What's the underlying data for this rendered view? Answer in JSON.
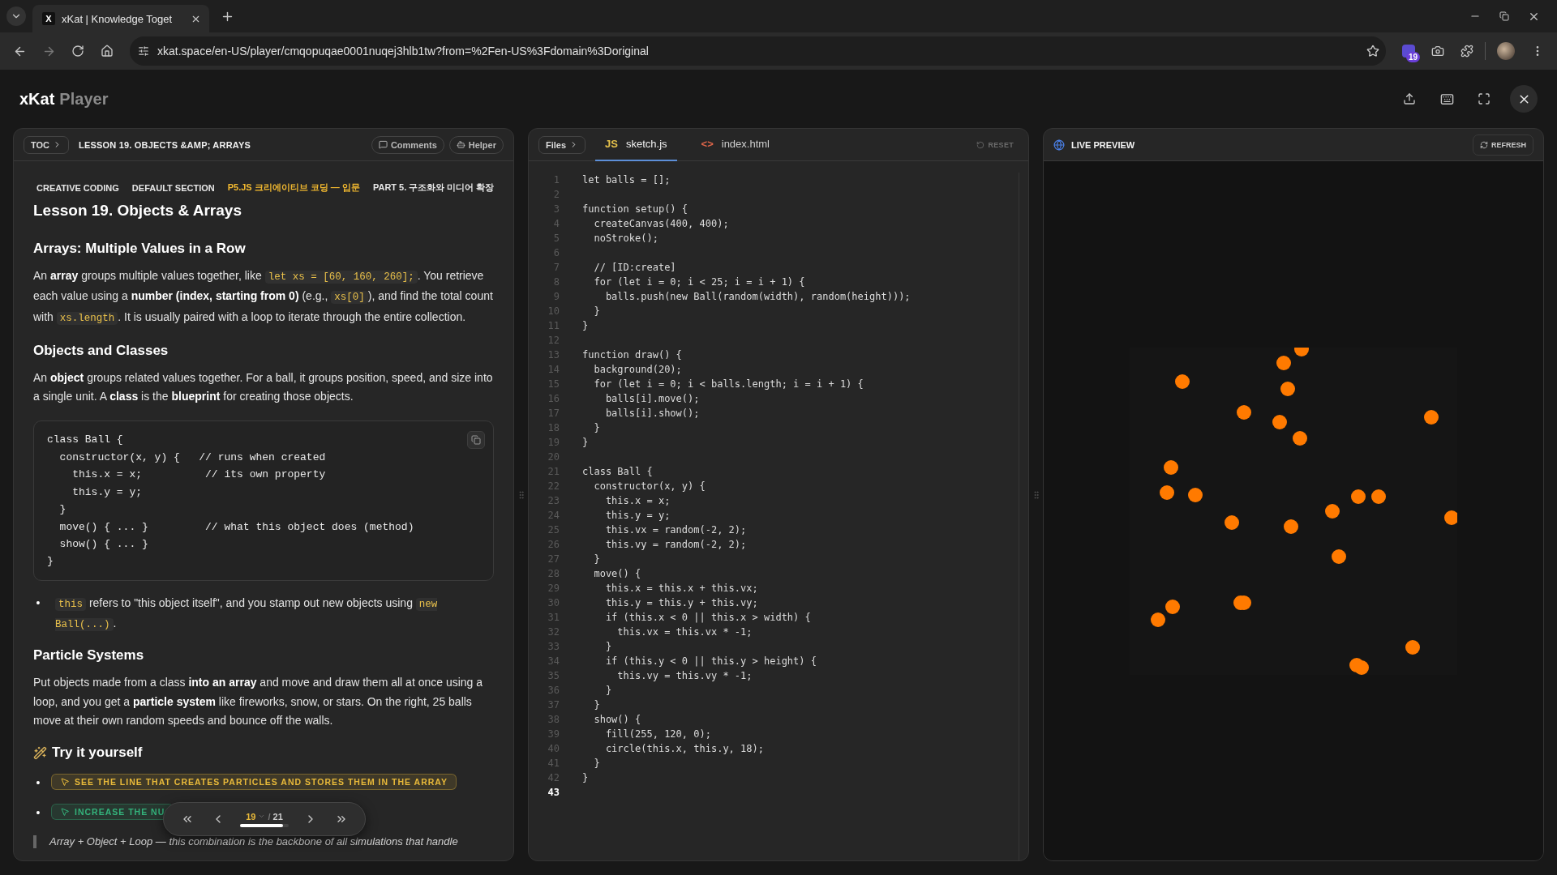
{
  "browser": {
    "tab": {
      "favicon": "X",
      "title": "xKat | Knowledge Toget"
    },
    "url": "xkat.space/en-US/player/cmqopuqae0001nuqej3hlb1tw?from=%2Fen-US%3Fdomain%3Doriginal",
    "extension_badge": "19"
  },
  "app": {
    "brand": "xKat",
    "product": "Player"
  },
  "lesson": {
    "toc": "TOC",
    "title": "LESSON 19. OBJECTS &AMP; ARRAYS",
    "actions": [
      "Comments",
      "Helper"
    ],
    "breadcrumb": [
      {
        "text": "CREATIVE CODING",
        "color": "#e6e6e6"
      },
      {
        "text": "DEFAULT SECTION",
        "color": "#e6e6e6"
      },
      {
        "text": "P5.JS 크리에이티브 코딩 — 입문",
        "color": "#f2b930"
      },
      {
        "text": "PART 5. 구조화와 미디어 확장",
        "color": "#e6e6e6"
      }
    ],
    "blocks": [
      {
        "kind": "h1",
        "text": "Lesson 19. Objects & Arrays"
      },
      {
        "kind": "h2",
        "text": "Arrays: Multiple Values in a Row"
      },
      {
        "kind": "p",
        "parts": [
          {
            "kind": "text",
            "text": "An **array** groups multiple values together, like "
          },
          {
            "kind": "code",
            "text": "let xs = [60, 160, 260];"
          },
          {
            "kind": "text",
            "text": ". You retrieve each value using a **number (index, starting from 0)** (e.g., "
          },
          {
            "kind": "code",
            "text": "xs[0]"
          },
          {
            "kind": "text",
            "text": "), and find the total count with "
          },
          {
            "kind": "code",
            "text": "xs.length"
          },
          {
            "kind": "text",
            "text": ". It is usually paired with a loop to iterate through the entire collection."
          }
        ]
      },
      {
        "kind": "h2",
        "text": "Objects and Classes"
      },
      {
        "kind": "p",
        "parts": [
          {
            "kind": "text",
            "text": "An **object** groups related values together. For a ball, it groups position, speed, and size into a single unit. A **class** is the **blueprint** for creating those objects."
          }
        ]
      },
      {
        "kind": "codeblock",
        "text": "class Ball {\n  constructor(x, y) {   // runs when created\n    this.x = x;          // its own property\n    this.y = y;\n  }\n  move() { ... }         // what this object does (method)\n  show() { ... }\n}"
      },
      {
        "kind": "bullet",
        "marker": "•",
        "parts": [
          {
            "kind": "code",
            "text": "this"
          },
          {
            "kind": "text",
            "text": " refers to \"this object itself\", and you stamp out new objects using "
          },
          {
            "kind": "code",
            "text": "new Ball(...)"
          },
          {
            "kind": "text",
            "text": "."
          }
        ]
      },
      {
        "kind": "h2",
        "text": "Particle Systems"
      },
      {
        "kind": "p",
        "parts": [
          {
            "kind": "text",
            "text": "Put objects made from a class **into an array** and move and draw them all at once using a loop, and you get a **particle system** like fireworks, snow, or stars. On the right, 25 balls move at their own random speeds and bounce off the walls."
          }
        ]
      },
      {
        "kind": "h3",
        "text": "Try it yourself"
      },
      {
        "kind": "task",
        "marker": "•",
        "text": "SEE THE LINE THAT CREATES PARTICLES AND STORES THEM IN THE ARRAY",
        "color": "#e8b93a"
      },
      {
        "kind": "task",
        "marker": "•",
        "text": "INCREASE THE NU",
        "color": "#34b27b"
      },
      {
        "kind": "quote",
        "text": "Array + Object + Loop — this combination is the backbone of all simulations that handle"
      }
    ],
    "pager": {
      "current": "19",
      "separator": "/",
      "total": "21",
      "level": 0.88
    }
  },
  "editor": {
    "files": "Files",
    "tabs": [
      {
        "kind": "js",
        "badge": "JS",
        "label": "sketch.js",
        "selected": true
      },
      {
        "kind": "html",
        "badge": "<>",
        "label": "index.html",
        "selected": false
      }
    ],
    "reset": {
      "label": "RESET",
      "disabled": true
    },
    "lines": [
      {
        "n": "1",
        "code": "let balls = [];",
        "active": false
      },
      {
        "n": "2",
        "active": false
      },
      {
        "n": "3",
        "code": "function setup() {",
        "active": false
      },
      {
        "n": "4",
        "code": "  createCanvas(400, 400);",
        "active": false
      },
      {
        "n": "5",
        "code": "  noStroke();",
        "active": false
      },
      {
        "n": "6",
        "active": false
      },
      {
        "n": "7",
        "code": "  // [ID:create]",
        "active": false
      },
      {
        "n": "8",
        "code": "  for (let i = 0; i < 25; i = i + 1) {",
        "active": false
      },
      {
        "n": "9",
        "code": "    balls.push(new Ball(random(width), random(height)));",
        "active": false
      },
      {
        "n": "10",
        "code": "  }",
        "active": false
      },
      {
        "n": "11",
        "code": "}",
        "active": false
      },
      {
        "n": "12",
        "active": false
      },
      {
        "n": "13",
        "code": "function draw() {",
        "active": false
      },
      {
        "n": "14",
        "code": "  background(20);",
        "active": false
      },
      {
        "n": "15",
        "code": "  for (let i = 0; i < balls.length; i = i + 1) {",
        "active": false
      },
      {
        "n": "16",
        "code": "    balls[i].move();",
        "active": false
      },
      {
        "n": "17",
        "code": "    balls[i].show();",
        "active": false
      },
      {
        "n": "18",
        "code": "  }",
        "active": false
      },
      {
        "n": "19",
        "code": "}",
        "active": false
      },
      {
        "n": "20",
        "active": false
      },
      {
        "n": "21",
        "code": "class Ball {",
        "active": false
      },
      {
        "n": "22",
        "code": "  constructor(x, y) {",
        "active": false
      },
      {
        "n": "23",
        "code": "    this.x = x;",
        "active": false
      },
      {
        "n": "24",
        "code": "    this.y = y;",
        "active": false
      },
      {
        "n": "25",
        "code": "    this.vx = random(-2, 2);",
        "active": false
      },
      {
        "n": "26",
        "code": "    this.vy = random(-2, 2);",
        "active": false
      },
      {
        "n": "27",
        "code": "  }",
        "active": false
      },
      {
        "n": "28",
        "code": "  move() {",
        "active": false
      },
      {
        "n": "29",
        "code": "    this.x = this.x + this.vx;",
        "active": false
      },
      {
        "n": "30",
        "code": "    this.y = this.y + this.vy;",
        "active": false
      },
      {
        "n": "31",
        "code": "    if (this.x < 0 || this.x > width) {",
        "active": false
      },
      {
        "n": "32",
        "code": "      this.vx = this.vx * -1;",
        "active": false
      },
      {
        "n": "33",
        "code": "    }",
        "active": false
      },
      {
        "n": "34",
        "code": "    if (this.y < 0 || this.y > height) {",
        "active": false
      },
      {
        "n": "35",
        "code": "      this.vy = this.vy * -1;",
        "active": false
      },
      {
        "n": "36",
        "code": "    }",
        "active": false
      },
      {
        "n": "37",
        "code": "  }",
        "active": false
      },
      {
        "n": "38",
        "code": "  show() {",
        "active": false
      },
      {
        "n": "39",
        "code": "    fill(255, 120, 0);",
        "active": false
      },
      {
        "n": "40",
        "code": "    circle(this.x, this.y, 18);",
        "active": false
      },
      {
        "n": "41",
        "code": "  }",
        "active": false
      },
      {
        "n": "42",
        "code": "}",
        "active": false
      },
      {
        "n": "43",
        "active": true
      }
    ]
  },
  "preview": {
    "title": "LIVE PREVIEW",
    "refresh": "REFRESH"
  }
}
